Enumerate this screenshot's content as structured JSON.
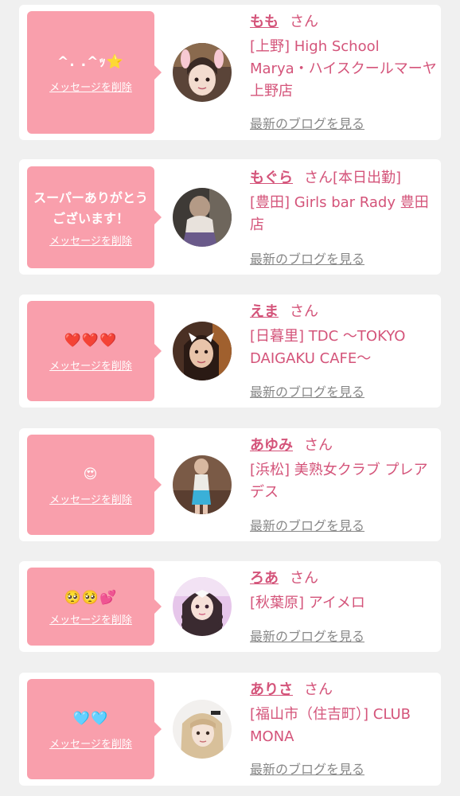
{
  "delete_label": "メッセージを削除",
  "san_label": "さん",
  "blog_label": "最新のブログを見る",
  "colors": {
    "bubble": "#f99fac",
    "accent": "#d4547a",
    "link_gray": "#888888",
    "background": "#f0f0f0",
    "card": "#ffffff"
  },
  "messages": [
    {
      "message": "^. .^ｯ⭐",
      "name": "もも",
      "name_suffix": "",
      "shop": "[上野] High School Marya・ハイスクールマーヤ上野店",
      "avatar_icon": "girl-with-bunny-ears-photo"
    },
    {
      "message": "スーパーありがとうございます！",
      "name": "もぐら",
      "name_suffix": "[本日出勤]",
      "shop": "[豊田] Girls bar Rady 豊田店",
      "avatar_icon": "girl-back-view-photo"
    },
    {
      "message": "❤️❤️❤️",
      "name": "えま",
      "name_suffix": "",
      "shop": "[日暮里] TDC 〜TOKYO DAIGAKU CAFE〜",
      "avatar_icon": "girl-with-cat-ears-photo"
    },
    {
      "message": "😍",
      "name": "あゆみ",
      "name_suffix": "",
      "shop": "[浜松] 美熟女クラブ プレアデス",
      "avatar_icon": "woman-standing-photo"
    },
    {
      "message": "🥺🥺💕",
      "name": "ろあ",
      "name_suffix": "",
      "shop": "[秋葉原] アイメロ",
      "avatar_icon": "girl-twin-braids-photo"
    },
    {
      "message": "🩵🩵",
      "name": "ありさ",
      "name_suffix": "",
      "shop": "[福山市（住吉町）] CLUB MONA",
      "avatar_icon": "blonde-girl-photo"
    }
  ]
}
